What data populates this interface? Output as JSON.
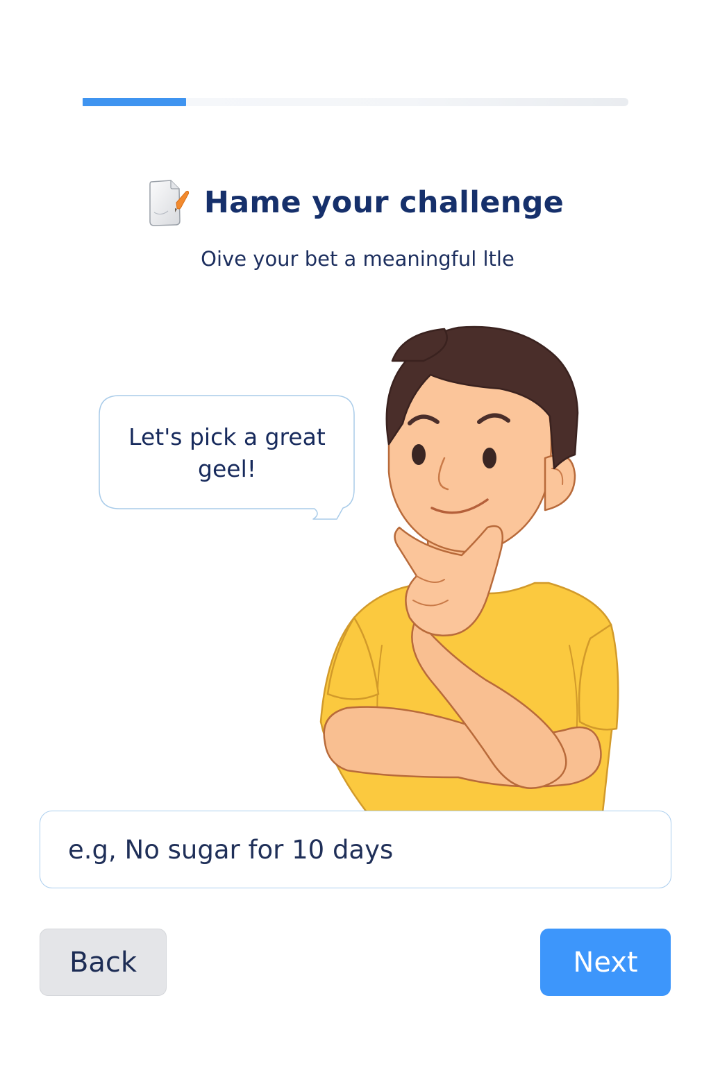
{
  "progress": {
    "value": 0.19,
    "accent_color": "#3f94f0"
  },
  "header": {
    "icon": "memo-pencil-icon",
    "title": "Hame your challenge",
    "subtitle": "Oive your bet a meaningful ltle"
  },
  "speech_bubble": {
    "text": "Let's pick a great geel!"
  },
  "illustration": {
    "subject": "thinking-man-illustration",
    "shirt_color": "#fbc93f",
    "hair_color": "#4a2e2a",
    "skin_color": "#fbc59a"
  },
  "challenge_input": {
    "value": "",
    "placeholder": "e.g, No sugar for 10 days"
  },
  "actions": {
    "back_label": "Back",
    "next_label": "Next",
    "next_color": "#3d96fb"
  }
}
